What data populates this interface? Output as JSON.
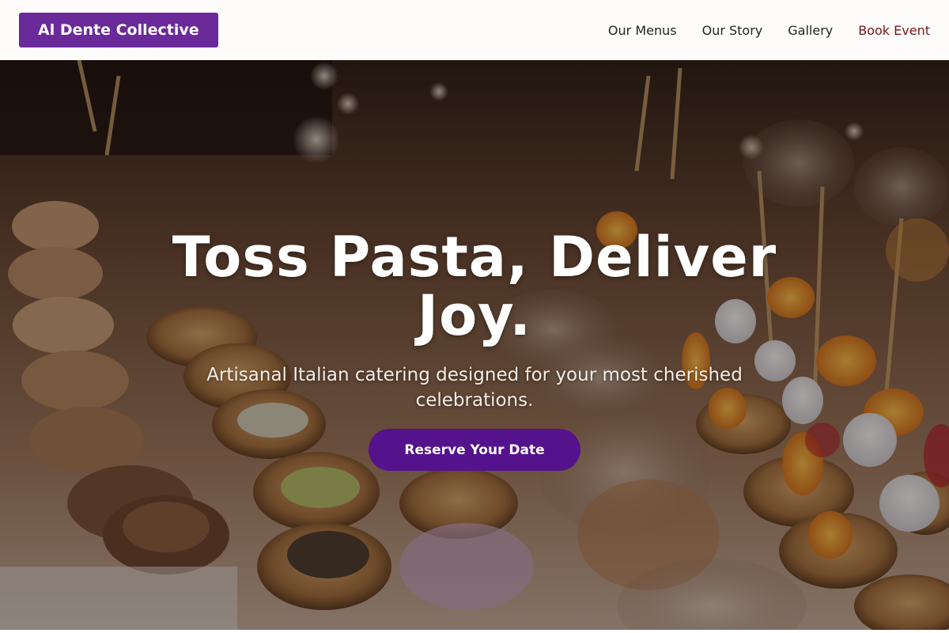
{
  "header": {
    "brand": "Al Dente Collective",
    "nav": [
      {
        "label": "Our Menus"
      },
      {
        "label": "Our Story"
      },
      {
        "label": "Gallery"
      },
      {
        "label": "Book Event"
      }
    ]
  },
  "hero": {
    "title": "Toss Pasta, Deliver Joy.",
    "subtitle": "Artisanal Italian catering designed for your most cherished celebrations.",
    "cta_label": "Reserve Your Date",
    "background_image": "catering-appetizers-photo"
  },
  "colors": {
    "brand": "#6a2a9a",
    "cta_button": "#54128c",
    "book_event_link": "#7a1418",
    "header_bg": "#fdfcfb"
  }
}
